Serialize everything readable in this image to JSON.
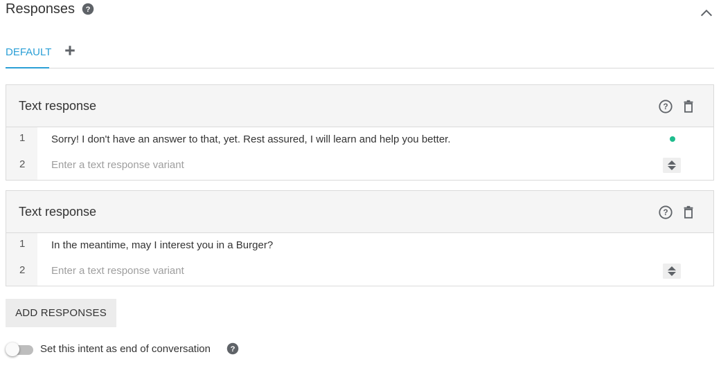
{
  "header": {
    "title": "Responses",
    "help_icon": "help-icon",
    "collapse_icon": "chevron-up-icon"
  },
  "tabs": {
    "items": [
      {
        "label": "DEFAULT",
        "active": true
      }
    ],
    "add_icon": "plus-icon"
  },
  "cards": [
    {
      "title": "Text response",
      "rows": [
        {
          "num": "1",
          "text": "Sorry! I don't have an answer to that, yet. Rest assured, I will learn and help you better."
        },
        {
          "num": "2",
          "placeholder": "Enter a text response variant"
        }
      ]
    },
    {
      "title": "Text response",
      "rows": [
        {
          "num": "1",
          "text": "In the meantime, may I interest you in a Burger?"
        },
        {
          "num": "2",
          "placeholder": "Enter a text response variant"
        }
      ]
    }
  ],
  "add_button_label": "ADD RESPONSES",
  "end_conversation": {
    "label": "Set this intent as end of conversation",
    "enabled": false
  },
  "colors": {
    "accent": "#2a9fd6",
    "status_dot": "#1ebc8d",
    "icon": "#5f6368"
  }
}
